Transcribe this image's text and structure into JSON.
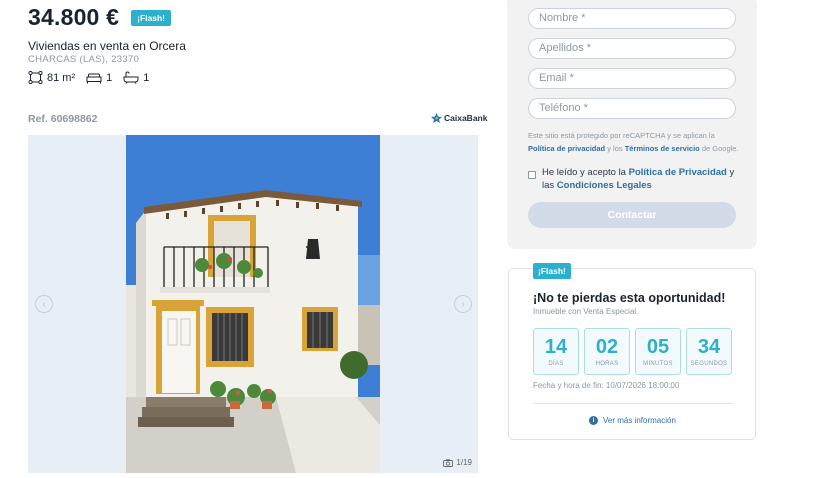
{
  "listing": {
    "price": "34.800 €",
    "flash_badge": "¡Flash!",
    "title": "Viviendas en venta en Orcera",
    "location": "CHARCAS (LAS), 23370",
    "features": {
      "area": "81 m²",
      "bedrooms": "1",
      "bathrooms": "1"
    },
    "reference": "Ref. 60698862",
    "bank": "CaixaBank",
    "gallery_counter": "1/19"
  },
  "form": {
    "name_placeholder": "Nombre *",
    "surname_placeholder": "Apellidos *",
    "email_placeholder": "Email *",
    "phone_placeholder": "Teléfono *",
    "legal_prefix": "Este sitio está protegido por reCAPTCHA y se aplican la",
    "privacy_link": "Política de privacidad",
    "legal_and": "y los",
    "terms_link": "Términos de servicio",
    "legal_suffix": "de Google.",
    "consent_prefix": "He leído y acepto la",
    "consent_privacy": "Política de Privacidad",
    "consent_and": "y las",
    "consent_conditions": "Condiciones Legales",
    "submit_label": "Contactar"
  },
  "promo": {
    "badge": "¡Flash!",
    "title": "¡No te pierdas esta oportunidad!",
    "subtitle": "Inmueble con Venta Especial.",
    "countdown": [
      {
        "value": "14",
        "label": "DÍAS"
      },
      {
        "value": "02",
        "label": "HORAS"
      },
      {
        "value": "05",
        "label": "MINUTOS"
      },
      {
        "value": "34",
        "label": "SEGUNDOS"
      }
    ],
    "end_text": "Fecha y hora de fin: 10/07/2026 18:00:00",
    "more_info": "Ver más información"
  },
  "colors": {
    "accent": "#2bb0cf",
    "link": "#2f6fa3",
    "button_disabled": "#d3dbe8"
  }
}
